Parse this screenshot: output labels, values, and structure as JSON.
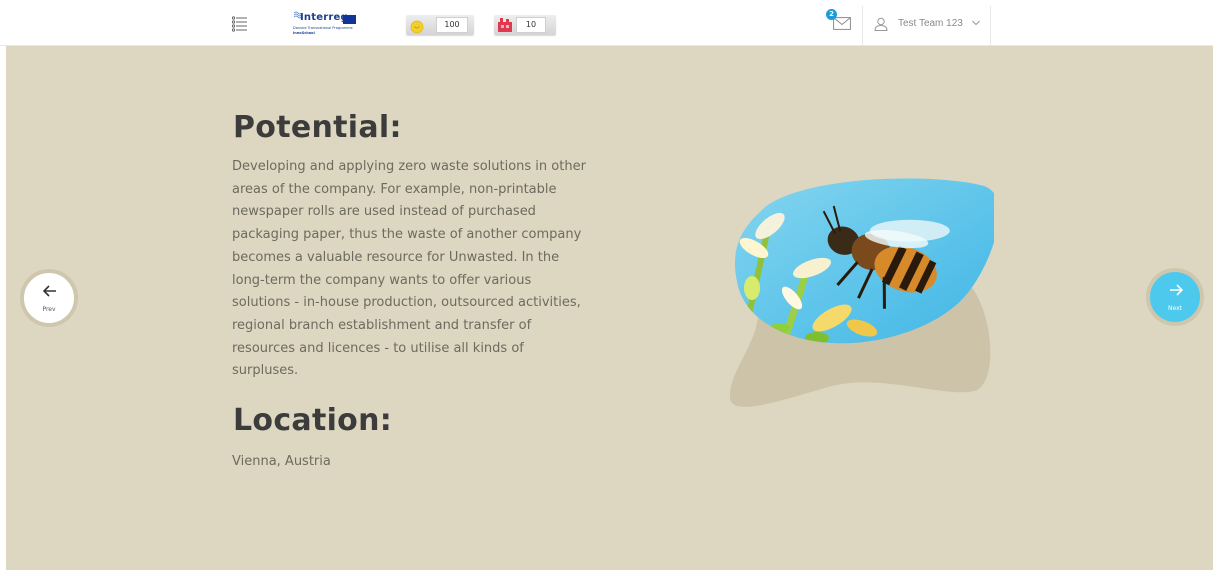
{
  "header": {
    "logo": {
      "name": "Interreg",
      "subtitle_1": "Danube Transnational Programme",
      "subtitle_2": "InnoSchool"
    },
    "resources": [
      {
        "icon": "sun-icon",
        "value": "100"
      },
      {
        "icon": "factory-icon",
        "value": "10"
      }
    ],
    "messages": {
      "icon": "envelope-icon",
      "unread_count": "2"
    },
    "user": {
      "icon": "user-icon",
      "name": "Test Team 123"
    }
  },
  "content": {
    "potential_heading": "Potential:",
    "potential_text": "Developing and applying zero waste solutions in other areas of the company. For example, non-printable newspaper rolls are used instead of purchased packaging paper, thus the waste of another company becomes a valuable resource for Unwasted. In the long-term the company wants to offer various solutions - in-house production, outsourced activities, regional branch establishment and transfer of resources and licences - to utilise all kinds of surpluses.",
    "location_heading": "Location:",
    "location_text": "Vienna, Austria"
  },
  "navigation": {
    "prev_label": "Prev",
    "next_label": "Next"
  },
  "colors": {
    "background": "#ddd6c0",
    "accent": "#4dc9ee",
    "badge": "#1f9ad6"
  }
}
